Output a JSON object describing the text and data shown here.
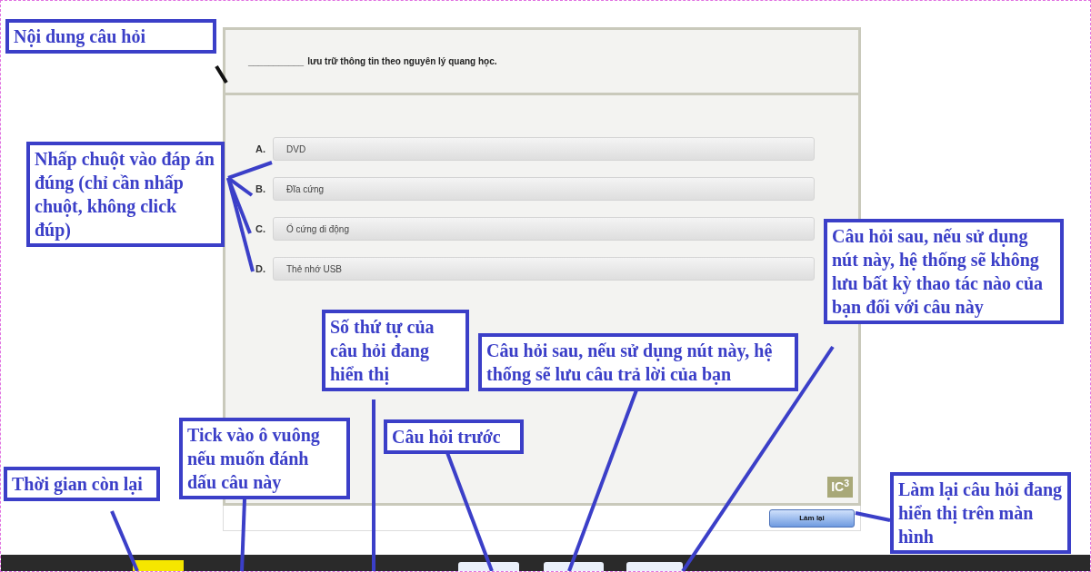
{
  "question": {
    "blank": "___________",
    "text": "lưu trữ thông tin theo nguyên lý quang học."
  },
  "options": [
    {
      "letter": "A.",
      "text": "DVD"
    },
    {
      "letter": "B.",
      "text": "Đĩa cứng"
    },
    {
      "letter": "C.",
      "text": "Ổ cứng di động"
    },
    {
      "letter": "D.",
      "text": "Thẻ nhớ USB"
    }
  ],
  "logo_text": "IC$^{3}$",
  "reset_button": "Làm lại",
  "callouts": [
    {
      "text": "Nội dung câu hỏi"
    },
    {
      "text": "Nhấp chuột vào đáp án đúng (chỉ cần nhấp chuột, không click đúp)"
    },
    {
      "text": "Câu hỏi sau, nếu sử dụng nút này, hệ thống sẽ không lưu bất kỳ thao tác nào của bạn đối với câu này"
    },
    {
      "text": "Số thứ tự của câu hỏi đang hiển thị"
    },
    {
      "text": "Câu hỏi sau, nếu sử dụng nút này, hệ thống sẽ lưu câu trả lời của bạn"
    },
    {
      "text": "Câu hỏi trước"
    },
    {
      "text": "Thời gian còn lại"
    },
    {
      "text": "Tick vào ô vuông nếu muốn đánh dấu câu này"
    },
    {
      "text": "Làm lại câu hỏi đang hiển thị trên màn hình"
    }
  ]
}
